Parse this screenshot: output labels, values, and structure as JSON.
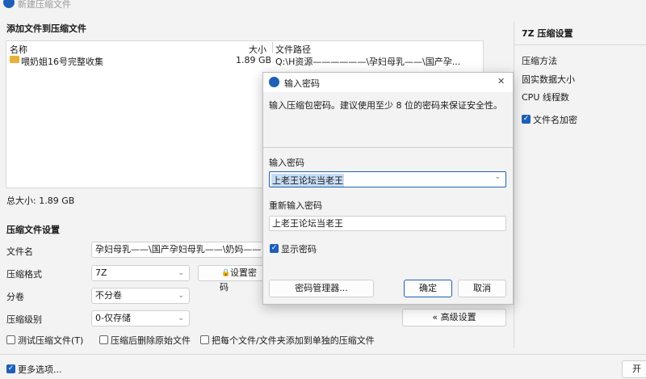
{
  "window": {
    "title": "新建压缩文件"
  },
  "files": {
    "section_title": "添加文件到压缩文件",
    "columns": [
      "名称",
      "大小",
      "文件路径"
    ],
    "rows": [
      {
        "name": "喂奶姐16号完整收集",
        "size": "1.89 GB",
        "path": "Q:\\H资源——————\\孕妇母乳——\\国产孕..."
      }
    ],
    "total": "总大小: 1.89 GB"
  },
  "settings": {
    "section_title": "压缩文件设置",
    "filename_label": "文件名",
    "filename_value": "孕妇母乳——\\国产孕妇母乳——\\奶妈——",
    "format_label": "压缩格式",
    "format_value": "7Z",
    "set_password_label": "设置密码",
    "volume_label": "分卷",
    "volume_value": "不分卷",
    "level_label": "压缩级别",
    "level_value": "0-仅存储",
    "advanced_label": "« 高级设置",
    "test_label": "测试压缩文件(T)",
    "delete_label": "压缩后删除原始文件",
    "separate_label": "把每个文件/文件夹添加到单独的压缩文件"
  },
  "bottom": {
    "more_options": "更多选项...",
    "right_btn_fragment": "开"
  },
  "right_panel": {
    "title": "7Z 压缩设置",
    "method_label": "压缩方法",
    "solid_label": "固实数据大小",
    "cpu_label": "CPU 线程数",
    "encrypt_label": "文件名加密"
  },
  "dialog": {
    "title": "输入密码",
    "description": "输入压缩包密码。建议使用至少 8 位的密码来保证安全性。",
    "password_label": "输入密码",
    "password_value": "上老王论坛当老王",
    "confirm_label": "重新输入密码",
    "confirm_value": "上老王论坛当老王",
    "show_password_label": "显示密码",
    "manager_button": "密码管理器...",
    "ok_button": "确定",
    "cancel_button": "取消",
    "close_glyph": "✕"
  },
  "colors": {
    "accent": "#1f5fb8",
    "selection": "#c7dcf5",
    "folder": "#e8b23a"
  }
}
